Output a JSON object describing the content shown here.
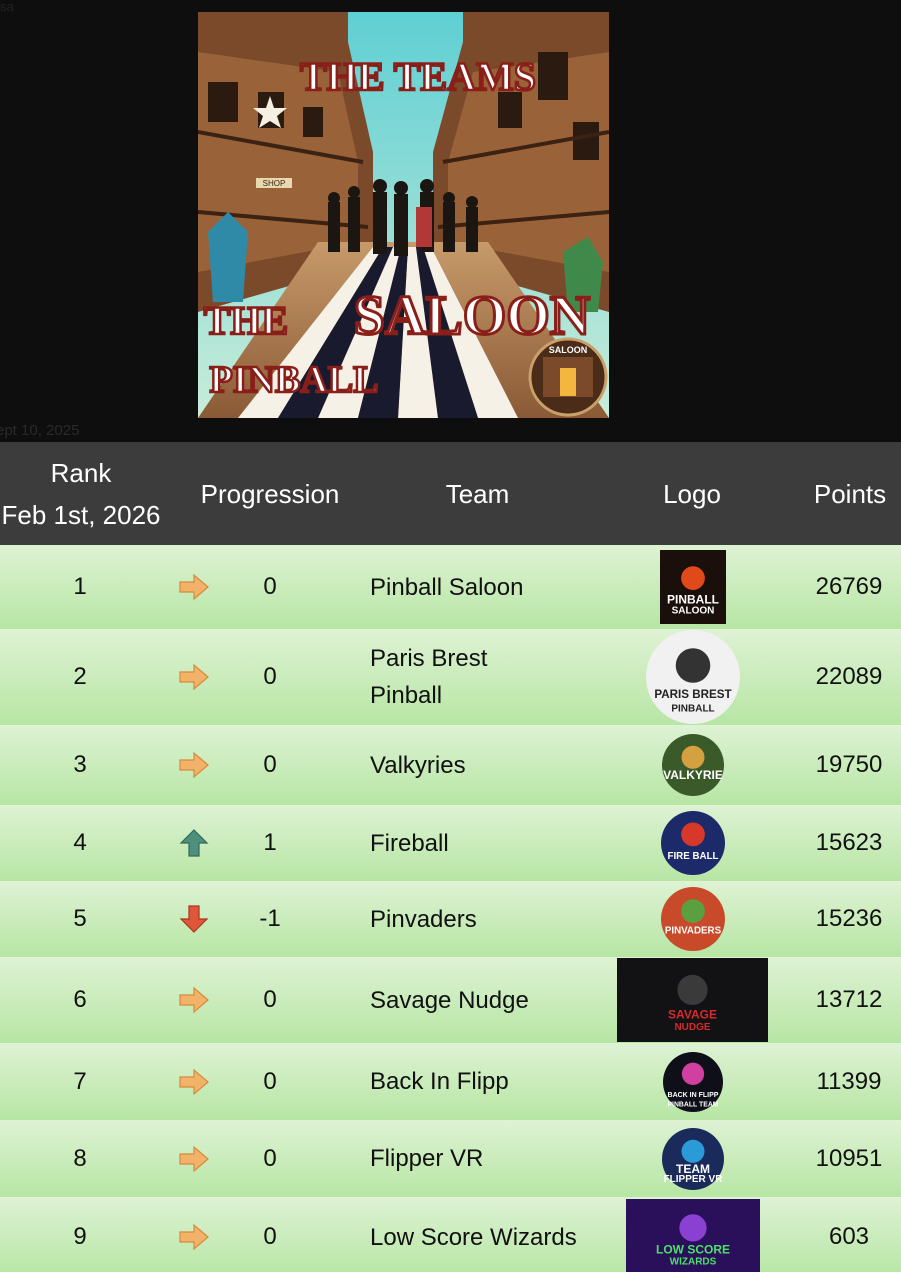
{
  "corner_label": "sa",
  "hero": {
    "title_top": "THE TEAMS",
    "title_the": "THE",
    "title_saloon": "SALOON",
    "title_pinball": "PINBALL",
    "sign_small": "SALOON",
    "sign_shop": "SHOP"
  },
  "date_label": "ept 10, 2025",
  "table": {
    "headers": {
      "rank_line1": "Rank",
      "rank_line2": "Feb 1st, 2026",
      "progression": "Progression",
      "team": "Team",
      "logo": "Logo",
      "points": "Points"
    },
    "rows": [
      {
        "rank": "1",
        "trend": "same",
        "progression": "0",
        "team": "Pinball Saloon",
        "points": "26769",
        "logo_text": "PINBALL",
        "logo_sub": "SALOON"
      },
      {
        "rank": "2",
        "trend": "same",
        "progression": "0",
        "team": "Paris Brest Pinball",
        "points": "22089",
        "logo_text": "PARIS BREST",
        "logo_sub": "PINBALL"
      },
      {
        "rank": "3",
        "trend": "same",
        "progression": "0",
        "team": "Valkyries",
        "points": "19750",
        "logo_text": "VALKYRIE",
        "logo_sub": ""
      },
      {
        "rank": "4",
        "trend": "up",
        "progression": "1",
        "team": "Fireball",
        "points": "15623",
        "logo_text": "FIRE BALL",
        "logo_sub": ""
      },
      {
        "rank": "5",
        "trend": "down",
        "progression": "-1",
        "team": "Pinvaders",
        "points": "15236",
        "logo_text": "PINVADERS",
        "logo_sub": ""
      },
      {
        "rank": "6",
        "trend": "same",
        "progression": "0",
        "team": "Savage Nudge",
        "points": "13712",
        "logo_text": "SAVAGE",
        "logo_sub": "NUDGE"
      },
      {
        "rank": "7",
        "trend": "same",
        "progression": "0",
        "team": "Back In Flipp",
        "points": "11399",
        "logo_text": "BACK IN FLIPP",
        "logo_sub": "PINBALL TEAM"
      },
      {
        "rank": "8",
        "trend": "same",
        "progression": "0",
        "team": "Flipper VR",
        "points": "10951",
        "logo_text": "TEAM",
        "logo_sub": "FLIPPER VR"
      },
      {
        "rank": "9",
        "trend": "same",
        "progression": "0",
        "team": "Low Score Wizards",
        "points": "603",
        "logo_text": "LOW SCORE",
        "logo_sub": "WIZARDS"
      }
    ]
  },
  "colors": {
    "header_bg": "#3c3c3c",
    "row_top": "#def2d4",
    "row_bottom": "#b7e6a4",
    "arrow_same": "#f3b26a",
    "arrow_up": "#4f8f7d",
    "arrow_down": "#e0563a"
  }
}
